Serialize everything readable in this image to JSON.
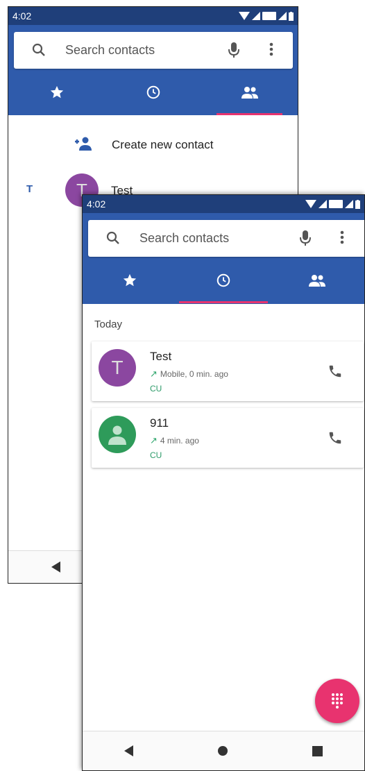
{
  "screens": {
    "contacts": {
      "status": {
        "time": "4:02"
      },
      "search": {
        "placeholder": "Search contacts"
      },
      "tabs": [
        "star-icon",
        "clock-icon",
        "people-icon"
      ],
      "active_tab": 2,
      "create_contact_label": "Create new contact",
      "contacts": [
        {
          "letter": "T",
          "avatar_letter": "T",
          "name": "Test"
        }
      ]
    },
    "recents": {
      "status": {
        "time": "4:02"
      },
      "search": {
        "placeholder": "Search contacts"
      },
      "active_tab": 1,
      "section": "Today",
      "calls": [
        {
          "name": "Test",
          "avatar_letter": "T",
          "detail": "Mobile, 0 min. ago",
          "sim": "CU",
          "color": "#8b47a0"
        },
        {
          "name": "911",
          "avatar_letter": "",
          "detail": "4 min. ago",
          "sim": "CU",
          "color": "#2e9b5a"
        }
      ]
    }
  },
  "colors": {
    "statusbar": "#1f3f7a",
    "appbar": "#2f5bab",
    "accent": "#e8336f"
  }
}
